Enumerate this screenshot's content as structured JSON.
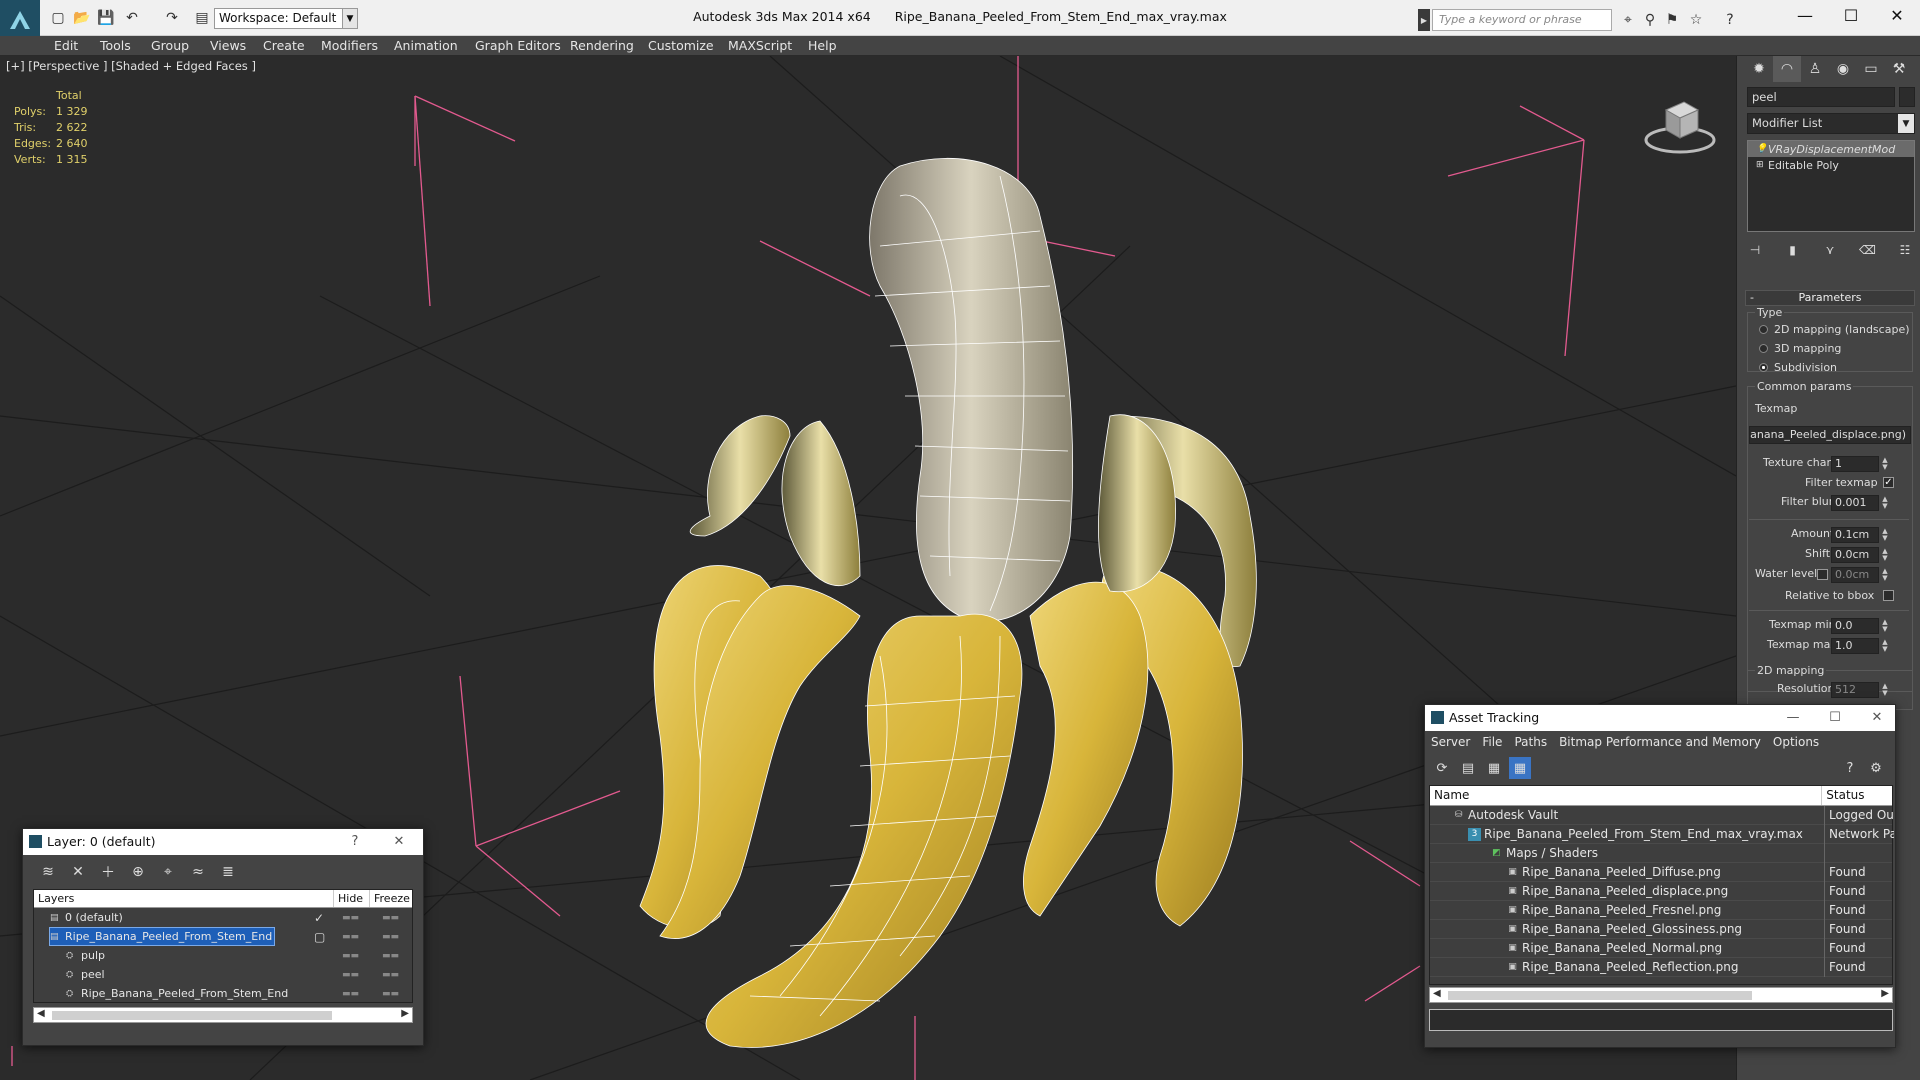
{
  "titlebar": {
    "workspace_label": "Workspace: Default",
    "app_title": "Autodesk 3ds Max  2014 x64",
    "file_title": "Ripe_Banana_Peeled_From_Stem_End_max_vray.max",
    "search_placeholder": "Type a keyword or phrase"
  },
  "menus": [
    "Edit",
    "Tools",
    "Group",
    "Views",
    "Create",
    "Modifiers",
    "Animation",
    "Graph Editors",
    "Rendering",
    "Customize",
    "MAXScript",
    "Help"
  ],
  "viewport": {
    "label": "[+] [Perspective ] [Shaded + Edged Faces ]",
    "stats": {
      "header": "Total",
      "rows": [
        {
          "k": "Polys:",
          "v": "1 329"
        },
        {
          "k": "Tris:",
          "v": "2 622"
        },
        {
          "k": "Edges:",
          "v": "2 640"
        },
        {
          "k": "Verts:",
          "v": "1 315"
        }
      ]
    }
  },
  "command_panel": {
    "object_name": "peel",
    "modifier_list": "Modifier List",
    "stack": [
      {
        "label": "VRayDisplacementMod",
        "selected": true
      },
      {
        "label": "Editable Poly",
        "selected": false
      }
    ],
    "parameters_title": "Parameters",
    "type_label": "Type",
    "type_options": [
      "2D mapping (landscape)",
      "3D mapping",
      "Subdivision"
    ],
    "type_selected": "Subdivision",
    "common_params": "Common params",
    "texmap_label": "Texmap",
    "texmap_value": "anana_Peeled_displace.png)",
    "texture_chan_label": "Texture chan",
    "texture_chan_value": "1",
    "filter_texmap_label": "Filter texmap",
    "filter_blur_label": "Filter blur",
    "filter_blur_value": "0.001",
    "amount_label": "Amount",
    "amount_value": "0.1cm",
    "shift_label": "Shift",
    "shift_value": "0.0cm",
    "water_level_label": "Water level",
    "water_level_value": "0.0cm",
    "relative_bbox_label": "Relative to bbox",
    "texmap_min_label": "Texmap min",
    "texmap_min_value": "0.0",
    "texmap_max_label": "Texmap max",
    "texmap_max_value": "1.0",
    "mapping2d_label": "2D mapping",
    "resolution_label": "Resolution",
    "resolution_value": "512"
  },
  "layer_window": {
    "title": "Layer: 0 (default)",
    "help": "?",
    "columns": [
      "Layers",
      "Hide",
      "Freeze"
    ],
    "rows": [
      {
        "name": "0 (default)",
        "indent": 1,
        "selected": false,
        "check": "✓"
      },
      {
        "name": "Ripe_Banana_Peeled_From_Stem_End",
        "indent": 1,
        "selected": true,
        "check": "▢"
      },
      {
        "name": "pulp",
        "indent": 2,
        "selected": false,
        "check": ""
      },
      {
        "name": "peel",
        "indent": 2,
        "selected": false,
        "check": ""
      },
      {
        "name": "Ripe_Banana_Peeled_From_Stem_End",
        "indent": 2,
        "selected": false,
        "check": ""
      }
    ]
  },
  "asset_window": {
    "title": "Asset Tracking",
    "menu": [
      "Server",
      "File",
      "Paths",
      "Bitmap Performance and Memory",
      "Options"
    ],
    "columns": [
      "Name",
      "Status"
    ],
    "rows": [
      {
        "name": "Autodesk Vault",
        "indent": 1,
        "status": "Logged Out"
      },
      {
        "name": "Ripe_Banana_Peeled_From_Stem_End_max_vray.max",
        "indent": 2,
        "status": "Network Path"
      },
      {
        "name": "Maps / Shaders",
        "indent": 3,
        "status": ""
      },
      {
        "name": "Ripe_Banana_Peeled_Diffuse.png",
        "indent": 4,
        "status": "Found"
      },
      {
        "name": "Ripe_Banana_Peeled_displace.png",
        "indent": 4,
        "status": "Found"
      },
      {
        "name": "Ripe_Banana_Peeled_Fresnel.png",
        "indent": 4,
        "status": "Found"
      },
      {
        "name": "Ripe_Banana_Peeled_Glossiness.png",
        "indent": 4,
        "status": "Found"
      },
      {
        "name": "Ripe_Banana_Peeled_Normal.png",
        "indent": 4,
        "status": "Found"
      },
      {
        "name": "Ripe_Banana_Peeled_Reflection.png",
        "indent": 4,
        "status": "Found"
      }
    ]
  },
  "colors": {
    "viewport_bg": "#2b2b2b",
    "panel_bg": "#444444",
    "selection": "#1e5fb8",
    "stats_text": "#e0d06a",
    "bbox_lines": "#e35a8f",
    "banana_yellow": "#d8b53a"
  }
}
